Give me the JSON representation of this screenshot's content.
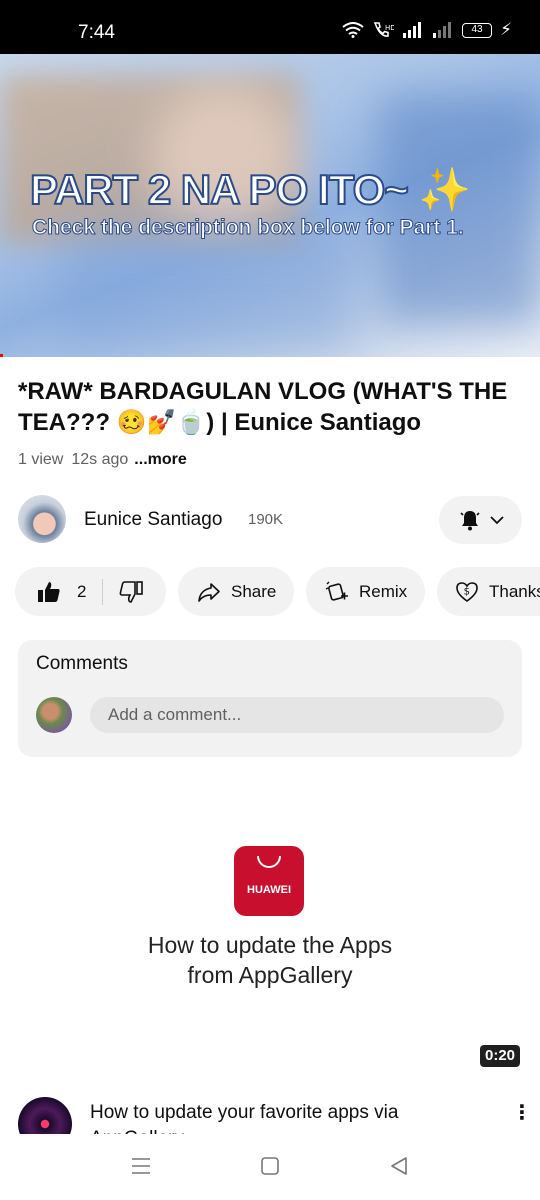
{
  "status_bar": {
    "time": "7:44",
    "battery": "43"
  },
  "video": {
    "overlay_title": "PART 2 NA PO ITO~ ✨",
    "overlay_subtitle": "Check the description box below for Part 1."
  },
  "details": {
    "title": "*RAW* BARDAGULAN VLOG (WHAT'S THE TEA??? 🥴💅🍵) | Eunice Santiago",
    "views": "1 view",
    "age": "12s ago",
    "more": "...more"
  },
  "channel": {
    "name": "Eunice Santiago",
    "subscribers": "190K"
  },
  "actions": {
    "like_count": "2",
    "share_label": "Share",
    "remix_label": "Remix",
    "thanks_label": "Thanks"
  },
  "comments": {
    "title": "Comments",
    "placeholder": "Add a comment..."
  },
  "next_video": {
    "brand": "HUAWEI",
    "thumb_line1": "How to update the Apps",
    "thumb_line2": "from AppGallery",
    "duration": "0:20",
    "title": "How to update your favorite apps via AppGallery"
  },
  "icons": {
    "status": [
      "wifi-icon",
      "volte-call-icon",
      "signal-icon",
      "battery-icon",
      "charging-icon"
    ],
    "actions": [
      "thumb-up-icon",
      "thumb-down-icon",
      "share-arrow-icon",
      "remix-icon",
      "thanks-icon",
      "bell-icon",
      "chevron-down-icon"
    ],
    "nav": [
      "menu-icon",
      "home-icon",
      "back-icon"
    ]
  }
}
